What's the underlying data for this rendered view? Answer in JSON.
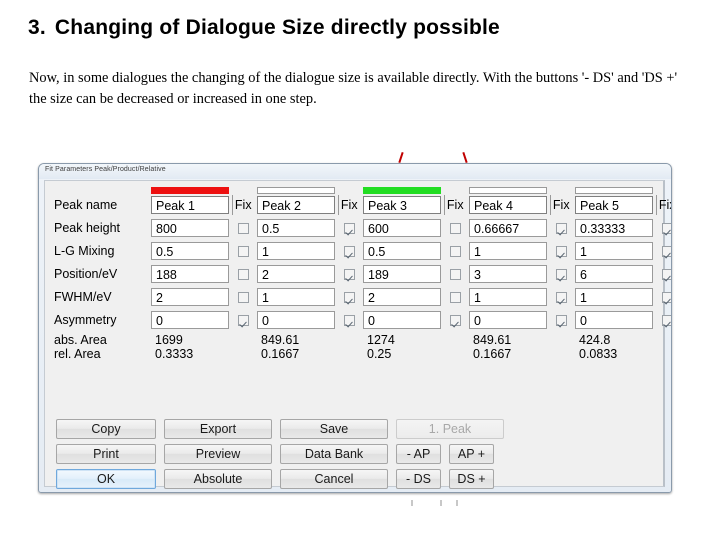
{
  "slide": {
    "heading_number": "3.",
    "heading_text": "Changing of Dialogue Size directly possible",
    "body_text": "Now, in some dialogues the changing of the dialogue size is available directly. With the buttons '- DS' and 'DS +' the size can be decreased or increased in one step."
  },
  "dialog": {
    "title": "Fit Parameters Peak/Product/Relative",
    "columns": [
      {
        "name": "Peak 1",
        "color": "#ee1111"
      },
      {
        "name": "Peak 2",
        "color": ""
      },
      {
        "name": "Peak 3",
        "color": "#22dd22"
      },
      {
        "name": "Peak 4",
        "color": ""
      },
      {
        "name": "Peak 5",
        "color": ""
      }
    ],
    "fix_header": "Fix",
    "rows": [
      {
        "label": "Peak name",
        "type": "name",
        "values": [
          "Peak 1",
          "Peak 2",
          "Peak 3",
          "Peak 4",
          "Peak 5"
        ]
      },
      {
        "label": "Peak height",
        "type": "input",
        "values": [
          "800",
          "0.5",
          "600",
          "0.66667",
          "0.33333"
        ],
        "fix": [
          false,
          true,
          false,
          true,
          true
        ]
      },
      {
        "label": "L-G Mixing",
        "type": "input",
        "values": [
          "0.5",
          "1",
          "0.5",
          "1",
          "1"
        ],
        "fix": [
          false,
          true,
          false,
          true,
          true
        ]
      },
      {
        "label": "Position/eV",
        "type": "input",
        "values": [
          "188",
          "2",
          "189",
          "3",
          "6"
        ],
        "fix": [
          false,
          true,
          false,
          true,
          true
        ]
      },
      {
        "label": "FWHM/eV",
        "type": "input",
        "values": [
          "2",
          "1",
          "2",
          "1",
          "1"
        ],
        "fix": [
          false,
          true,
          false,
          true,
          true
        ]
      },
      {
        "label": "Asymmetry",
        "type": "input",
        "values": [
          "0",
          "0",
          "0",
          "0",
          "0"
        ],
        "fix": [
          true,
          true,
          true,
          true,
          true
        ]
      },
      {
        "label": "abs. Area",
        "type": "readonly",
        "values": [
          "1699",
          "849.61",
          "1274",
          "849.61",
          "424.8"
        ]
      },
      {
        "label": "rel. Area",
        "type": "readonly",
        "values": [
          "0.3333",
          "0.1667",
          "0.25",
          "0.1667",
          "0.0833"
        ]
      }
    ],
    "buttons": [
      [
        {
          "label": "Copy",
          "state": "normal",
          "size": "w1"
        },
        {
          "label": "Export",
          "state": "normal",
          "size": "w2"
        },
        {
          "label": "Save",
          "state": "normal",
          "size": "w2"
        },
        {
          "label": "1. Peak",
          "state": "disabled",
          "size": "w2"
        }
      ],
      [
        {
          "label": "Print",
          "state": "normal",
          "size": "w1"
        },
        {
          "label": "Preview",
          "state": "normal",
          "size": "w2"
        },
        {
          "label": "Data Bank",
          "state": "normal",
          "size": "w2"
        },
        {
          "label": "- AP",
          "state": "normal",
          "size": "wsm"
        },
        {
          "label": "AP +",
          "state": "normal",
          "size": "wsm"
        }
      ],
      [
        {
          "label": "OK",
          "state": "focus",
          "size": "w1"
        },
        {
          "label": "Absolute",
          "state": "normal",
          "size": "w2"
        },
        {
          "label": "Cancel",
          "state": "normal",
          "size": "w2"
        },
        {
          "label": "- DS",
          "state": "normal",
          "size": "wsm"
        },
        {
          "label": "DS +",
          "state": "normal",
          "size": "wsm"
        }
      ]
    ]
  }
}
